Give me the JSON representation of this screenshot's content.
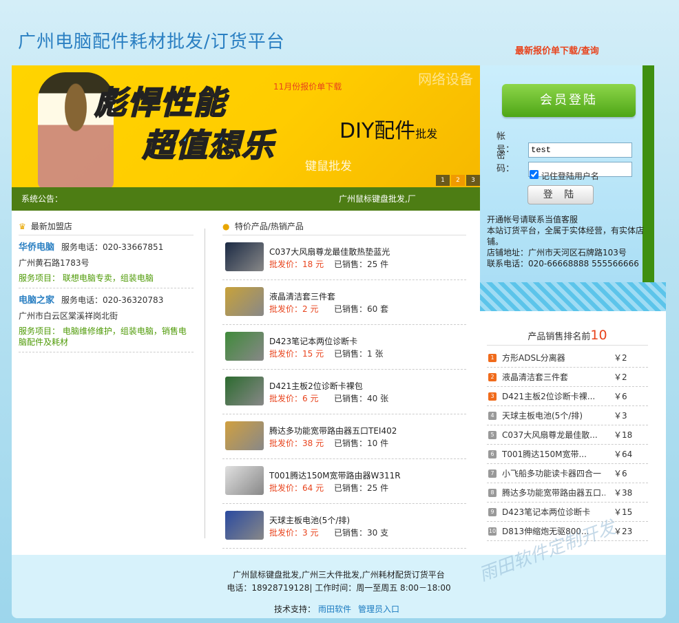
{
  "header": {
    "title": "广州电脑配件耗材批发/订货平台",
    "top_link": "最新报价单下载/查询"
  },
  "banner": {
    "headline1": "彪悍性能",
    "headline2": "超值想乐",
    "download_text": "11月份报价单下载",
    "watermark_text": "网络设备",
    "diy_text": "DIY配件",
    "diy_small": "批发",
    "keyboard_text": "键鼠批发",
    "pager": [
      "1",
      "2",
      "3"
    ],
    "pager_active": 1
  },
  "notice": {
    "label": "系统公告：",
    "marquee": "广州鼠标键盘批发,厂"
  },
  "login": {
    "title": "会员登陆",
    "account_label": "帐 号：",
    "account_value": "test",
    "password_label": "密 码：",
    "remember_label": "记住登陆用户名",
    "submit_label": "登 陆",
    "info_lines": [
      "开通帐号请联系当值客服",
      "本站订货平台，全属于实体经营，有实体店铺。",
      "店铺地址：广州市天河区石牌路103号",
      "联系电话：020-66668888 555566666"
    ]
  },
  "shops": {
    "title": "最新加盟店",
    "items": [
      {
        "name": "华侨电脑",
        "tel": "服务电话：020-33667851",
        "address": "广州黄石路1783号",
        "services": "服务项目： 联想电脑专卖，组装电脑"
      },
      {
        "name": "电脑之家",
        "tel": "服务电话：020-36320783",
        "address": "广州市白云区棠溪祥岗北街",
        "services": "服务项目： 电脑维修维护，组装电脑，销售电脑配件及耗材"
      }
    ]
  },
  "products": {
    "title": "特价产品/热销产品",
    "items": [
      {
        "name": "C037大风扇尊龙最佳散热垫蓝光",
        "price": "批发价：18 元",
        "sold": "已销售：25 件",
        "color": "#1b2a44"
      },
      {
        "name": "液晶清洁套三件套",
        "price": "批发价：2 元",
        "sold": "已销售：60 套",
        "color": "#c8a23a"
      },
      {
        "name": "D423笔记本两位诊断卡",
        "price": "批发价：15 元",
        "sold": "已销售：1 张",
        "color": "#3f8a3a"
      },
      {
        "name": "D421主板2位诊断卡裸包",
        "price": "批发价：6 元",
        "sold": "已销售：40 张",
        "color": "#2c6b2f"
      },
      {
        "name": "腾达多功能宽带路由器五口TEI402",
        "price": "批发价：38 元",
        "sold": "已销售：10 件",
        "color": "#d0a040"
      },
      {
        "name": "T001腾达150M宽带路由器W311R",
        "price": "批发价：64 元",
        "sold": "已销售：25 件",
        "color": "#e0e0e0"
      },
      {
        "name": "天球主板电池(5个/排)",
        "price": "批发价：3 元",
        "sold": "已销售：30 支",
        "color": "#2a4aa0"
      }
    ]
  },
  "ranking": {
    "title": "产品销售排名前",
    "top_n": "10",
    "items": [
      {
        "n": "1",
        "name": "方形ADSL分离器",
        "price": "￥2"
      },
      {
        "n": "2",
        "name": "液晶清洁套三件套",
        "price": "￥2"
      },
      {
        "n": "3",
        "name": "D421主板2位诊断卡裸...",
        "price": "￥6"
      },
      {
        "n": "4",
        "name": "天球主板电池(5个/排)",
        "price": "￥3"
      },
      {
        "n": "5",
        "name": "C037大风扇尊龙最佳散...",
        "price": "￥18"
      },
      {
        "n": "6",
        "name": "T001腾达150M宽带...",
        "price": "￥64"
      },
      {
        "n": "7",
        "name": "小飞船多功能读卡器四合一",
        "price": "￥6"
      },
      {
        "n": "8",
        "name": "腾达多功能宽带路由器五口...",
        "price": "￥38"
      },
      {
        "n": "9",
        "name": "D423笔记本两位诊断卡",
        "price": "￥15"
      },
      {
        "n": "10",
        "name": "D813伸缩炮无驱800...",
        "price": "￥23"
      }
    ]
  },
  "footer": {
    "line1": "广州鼠标键盘批发,广州三大件批发,广州耗材配货订货平台",
    "line2": "电话：18928719128| 工作时间：周一至周五  8:00－18:00",
    "support_label": "技术支持：",
    "support_link": "雨田软件",
    "admin_link": "管理员入口"
  },
  "watermarks": [
    "雨田软件定制开发"
  ],
  "colors": {
    "brand_blue": "#2a7fc2",
    "accent_red": "#e8431c",
    "green": "#4d7d14"
  }
}
